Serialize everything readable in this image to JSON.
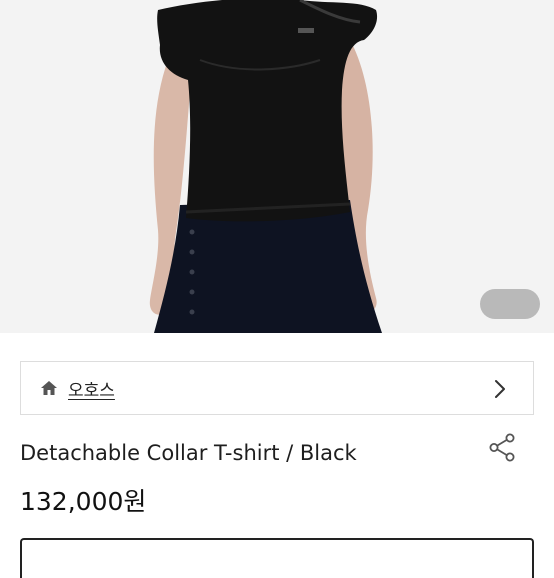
{
  "product": {
    "brand": "오호스",
    "title": "Detachable Collar T-shirt / Black",
    "price": "132,000원"
  },
  "icons": {
    "home": "home-icon",
    "chevron": "chevron-right-icon",
    "share": "share-icon"
  },
  "colors": {
    "background": "#f3f3f3",
    "garment": "#121212",
    "skirt": "#0e1322",
    "pager": "#b9b9b9",
    "border": "#dddddd"
  }
}
